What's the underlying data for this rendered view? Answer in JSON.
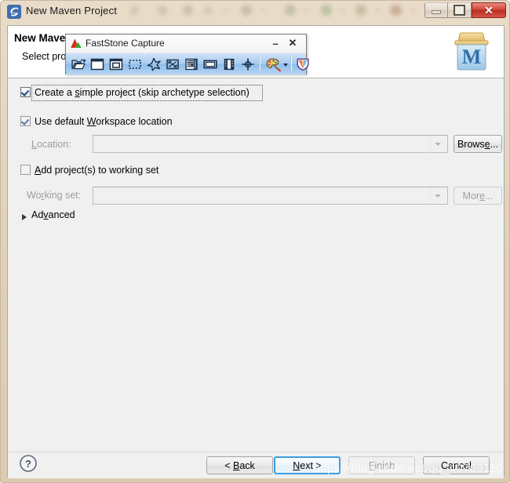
{
  "window": {
    "title": "New Maven Project",
    "icon": "eclipse-icon",
    "controls": {
      "minimize": "minimize-button",
      "maximize": "maximize-restore-button",
      "close_glyph": "✕"
    }
  },
  "dialog": {
    "header_title": "New Maven",
    "header_subtitle": "Select proj",
    "logo": "maven-logo",
    "form": {
      "create_simple_project": {
        "label_pre": "Create a ",
        "label_mnemonic": "s",
        "label_post": "imple project (skip archetype selection)",
        "checked": true,
        "focused": true
      },
      "use_default_workspace": {
        "label_pre": "Use default ",
        "label_mnemonic": "W",
        "label_post": "orkspace location",
        "checked": true,
        "focused": false
      },
      "location": {
        "label_pre": "",
        "label_mnemonic": "L",
        "label_post": "ocation:",
        "value": "",
        "disabled": true
      },
      "browse_button": {
        "label_pre": "Brows",
        "label_mnemonic": "e",
        "label_post": "...",
        "disabled": false
      },
      "add_to_working_set": {
        "label_pre": "",
        "label_mnemonic": "A",
        "label_post": "dd project(s) to working set",
        "checked": false,
        "focused": false
      },
      "working_set": {
        "label_pre": "Wo",
        "label_mnemonic": "r",
        "label_post": "king set:",
        "value": "",
        "disabled": true
      },
      "more_button": {
        "label_pre": "Mor",
        "label_mnemonic": "e",
        "label_post": "...",
        "disabled": true
      },
      "advanced": {
        "label_pre": "Ad",
        "label_mnemonic": "v",
        "label_post": "anced",
        "expanded": false
      }
    },
    "footer": {
      "help_icon": "help-icon",
      "buttons": [
        {
          "name": "back",
          "pre": "< ",
          "mnemonic": "B",
          "post": "ack",
          "disabled": false,
          "default": false
        },
        {
          "name": "next",
          "pre": "",
          "mnemonic": "N",
          "post": "ext >",
          "disabled": false,
          "default": true
        },
        {
          "name": "finish",
          "pre": "",
          "mnemonic": "F",
          "post": "inish",
          "disabled": true,
          "default": false
        },
        {
          "name": "cancel",
          "pre": "Cancel",
          "mnemonic": "",
          "post": "",
          "disabled": false,
          "default": false
        }
      ]
    }
  },
  "faststone": {
    "title": "FastStone Capture",
    "logo": "faststone-mountain-logo",
    "minimize_glyph": "–",
    "close_glyph": "✕",
    "tools": [
      {
        "name": "capture-active-window-icon",
        "tip": "Capture Active Window"
      },
      {
        "name": "capture-window-icon",
        "tip": "Capture Window / Object"
      },
      {
        "name": "capture-rectangular-icon",
        "tip": "Capture Rectangular Region"
      },
      {
        "name": "capture-freehand-icon",
        "tip": "Capture Freehand Region"
      },
      {
        "name": "capture-fullscreen-icon",
        "tip": "Capture Full Screen"
      },
      {
        "name": "capture-scrolling-window-icon",
        "tip": "Capture Scrolling Window"
      },
      {
        "name": "capture-fixed-region-icon",
        "tip": "Capture Fixed Region"
      },
      {
        "name": "screen-recorder-icon",
        "tip": "Screen Recorder"
      },
      {
        "name": "screen-magnifier-icon",
        "tip": "Screen Magnifier"
      },
      {
        "name": "color-picker-icon",
        "tip": "Color Picker"
      },
      {
        "name": "settings-icon",
        "tip": "Settings"
      }
    ]
  },
  "watermark": {
    "text": "https://blog.csdn.net/qq_40709110"
  },
  "colors": {
    "titlebar": "#e3d3bd",
    "dialog_bg": "#f0f0f0",
    "header_bg": "#ffffff",
    "close_button": "#c2342a",
    "default_button_border": "#3c9ede",
    "toolbar_blue": "#a8cdf0",
    "disabled_text": "#9d9d9d"
  }
}
